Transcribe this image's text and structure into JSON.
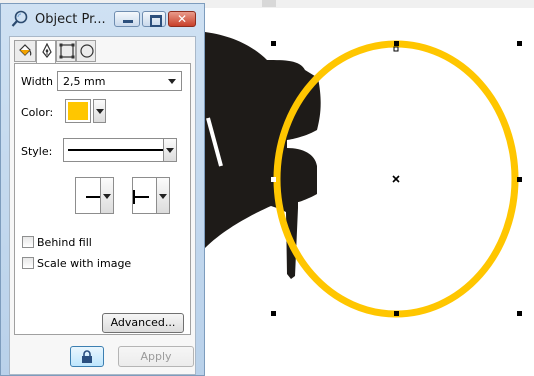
{
  "window": {
    "title": "Object Pr...",
    "controls": {
      "minimize": "minimize",
      "maximize": "maximize",
      "close": "✕"
    }
  },
  "tabs": [
    {
      "icon": "fill-bucket-icon",
      "active": false
    },
    {
      "icon": "pen-nib-icon",
      "active": true
    },
    {
      "icon": "transparency-icon",
      "active": false
    },
    {
      "icon": "circle-icon",
      "active": false
    }
  ],
  "outline": {
    "width_label": "Width",
    "width_value": "2,5 mm",
    "color_label": "Color:",
    "color_value": "#ffc600",
    "style_label": "Style:",
    "behind_fill_label": "Behind fill",
    "behind_fill_checked": false,
    "scale_with_image_label": "Scale with image",
    "scale_with_image_checked": false,
    "advanced_label": "Advanced..."
  },
  "footer": {
    "lock_icon": "lock-icon",
    "apply_label": "Apply"
  },
  "canvas": {
    "ellipse_outline_color": "#ffc600",
    "shape_fill_color": "#1e1b18"
  }
}
